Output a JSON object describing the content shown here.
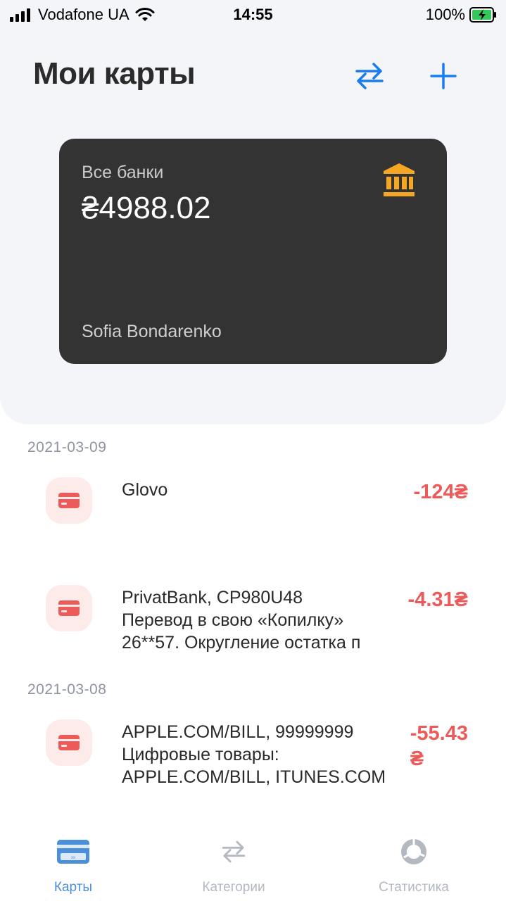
{
  "status_bar": {
    "carrier": "Vodafone UA",
    "time": "14:55",
    "battery": "100%"
  },
  "header": {
    "title": "Мои карты",
    "transfer_icon": "swap-arrows-icon",
    "add_icon": "plus-icon"
  },
  "card": {
    "label": "Все банки",
    "amount": "₴4988.02",
    "owner": "Sofia Bondarenko",
    "icon": "bank-icon"
  },
  "transactions": {
    "groups": [
      {
        "date": "2021-03-09",
        "items": [
          {
            "lines": [
              "Glovo"
            ],
            "amount": "-124₴"
          },
          {
            "lines": [
              "PrivatBank, CP980U48",
              "Перевод в свою «Копилку»",
              "26**57. Округление остатка п"
            ],
            "amount": "-4.31₴"
          }
        ]
      },
      {
        "date": "2021-03-08",
        "items": [
          {
            "lines": [
              "APPLE.COM/BILL, 99999999",
              "Цифровые товары:",
              "APPLE.COM/BILL, ITUNES.COM"
            ],
            "amount_line1": "-55.43",
            "amount_line2": "₴"
          }
        ]
      }
    ]
  },
  "tab_bar": {
    "tabs": [
      {
        "label": "Карты",
        "icon": "card-icon",
        "active": true
      },
      {
        "label": "Категории",
        "icon": "swap-arrows-icon",
        "active": false
      },
      {
        "label": "Статистика",
        "icon": "donut-chart-icon",
        "active": false
      }
    ]
  },
  "colors": {
    "accent": "#1a7cf0",
    "expense": "#ec5a5a",
    "card_bg": "#333333",
    "bank_icon": "#f5a623",
    "tab_active": "#4a8fd8",
    "tab_inactive": "#b3b8c1"
  }
}
